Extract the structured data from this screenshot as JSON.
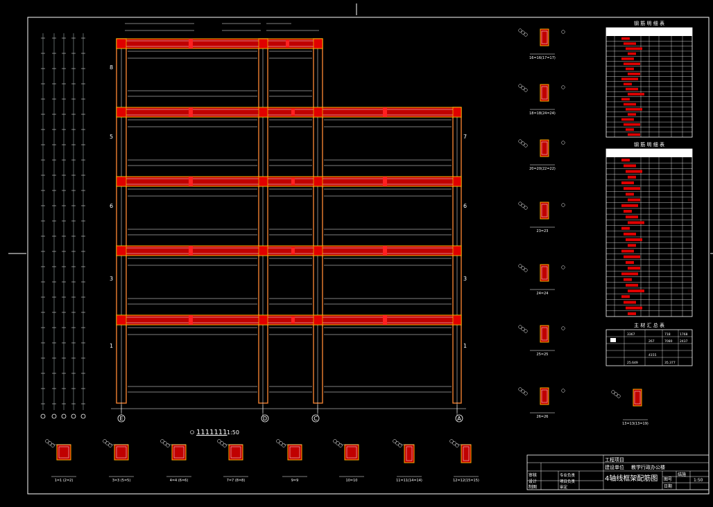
{
  "drawing": {
    "scale_label": "1111111",
    "scale_ratio": "1:50",
    "axis_bottom": [
      "E",
      "D",
      "C",
      "A"
    ],
    "floor_marks_left": [
      "8",
      "5",
      "6",
      "3",
      "1"
    ],
    "floor_marks_right": [
      "3",
      "7",
      "6",
      "4",
      "1"
    ]
  },
  "sections_bottom": [
    "1=1 (2=2)",
    "3=3 (5=5)",
    "4=4 (6=6)",
    "7=7 (8=8)",
    "9=9",
    "10=10",
    "11=11(14=14)",
    "12=12(15=15)"
  ],
  "sections_right": [
    "16=16(17=17)",
    "18=18(24=24)",
    "20=20(22=22)",
    "23=23",
    "24=24",
    "25=25",
    "26=26",
    "13=13(13=19)"
  ],
  "table1": {
    "title": "钢 筋 明 细 表",
    "rows": 20
  },
  "table2": {
    "title": "钢 筋 明 细 表",
    "rows": 28
  },
  "summary": {
    "title": "主 材 汇 总 表",
    "values": [
      "3367",
      "718",
      "1768",
      "267",
      "7080",
      "2437",
      "4155",
      "25.649",
      "35.377"
    ]
  },
  "title_block": {
    "row1_right": "工程项目",
    "row2_left": "建设单位",
    "row2_right": "教学行政办公楼",
    "labels_left": [
      "审核",
      "设计",
      "制图"
    ],
    "labels_mid": [
      "专业负责",
      "项目负责",
      "审定"
    ],
    "drawing_title": "4轴线框架配筋图",
    "labels_right": [
      "图号",
      "日期"
    ],
    "labels_far": [
      "结施",
      "1:50"
    ]
  }
}
